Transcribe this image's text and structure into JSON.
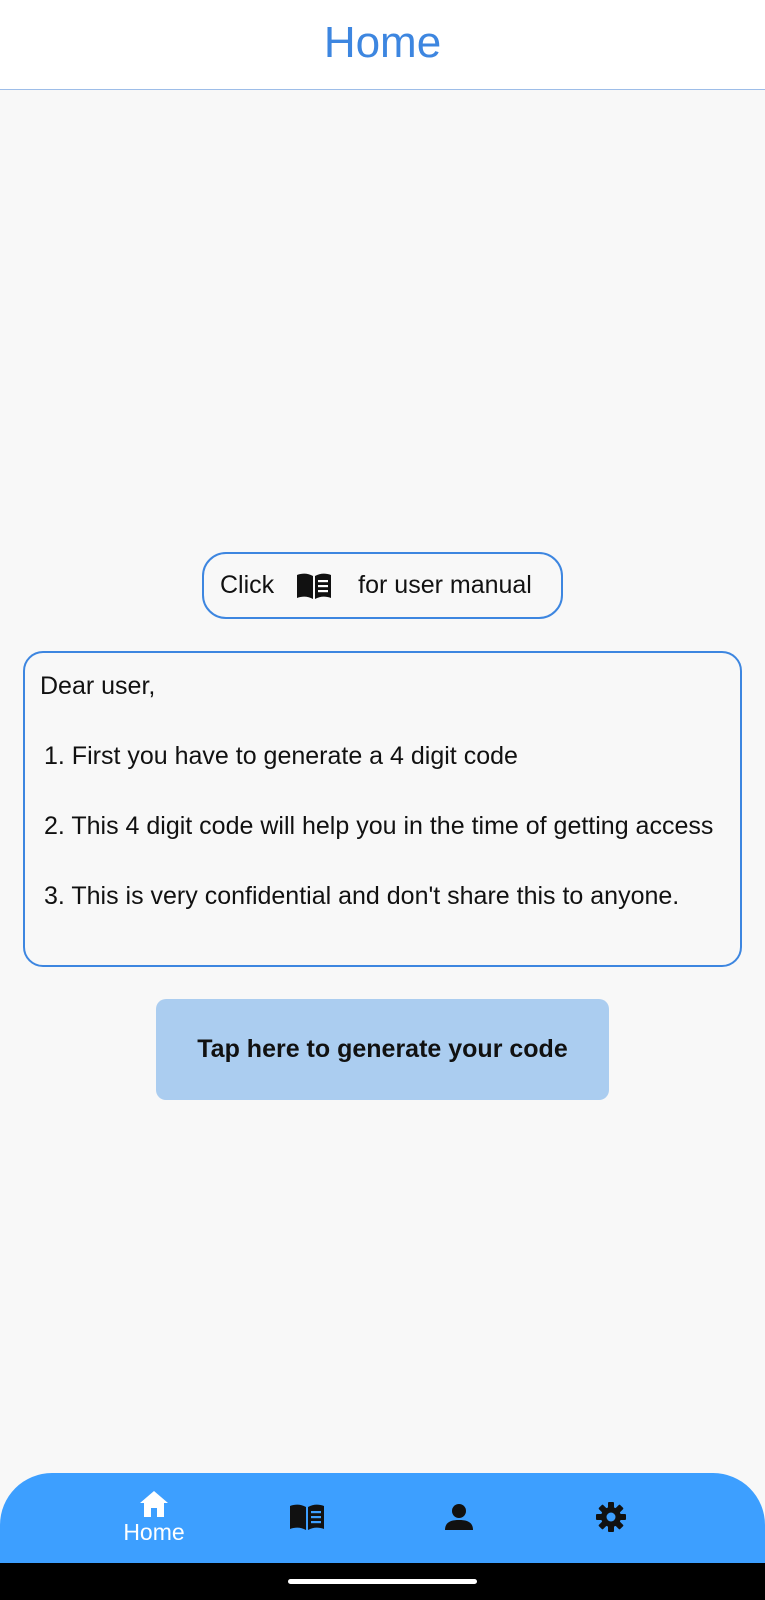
{
  "header": {
    "title": "Home"
  },
  "manual_hint": {
    "prefix": "Click",
    "icon": "book-icon",
    "suffix": "for user manual"
  },
  "info": {
    "greeting": "Dear user,",
    "items": [
      "1. First you have to generate a 4 digit code",
      "2. This 4 digit code will help you in the time of getting access",
      "3. This is very confidential and don't share this to anyone."
    ]
  },
  "generate_button": {
    "label": "Tap here to generate your code"
  },
  "bottom_nav": {
    "items": [
      {
        "icon": "home-icon",
        "label": "Home",
        "active": true
      },
      {
        "icon": "book-icon",
        "label": ""
      },
      {
        "icon": "person-icon",
        "label": ""
      },
      {
        "icon": "gear-icon",
        "label": ""
      }
    ]
  },
  "colors": {
    "accent": "#3d86e0",
    "nav_background": "#3d9fff",
    "button_background": "#abcdf0",
    "page_background": "#f8f8f8"
  }
}
